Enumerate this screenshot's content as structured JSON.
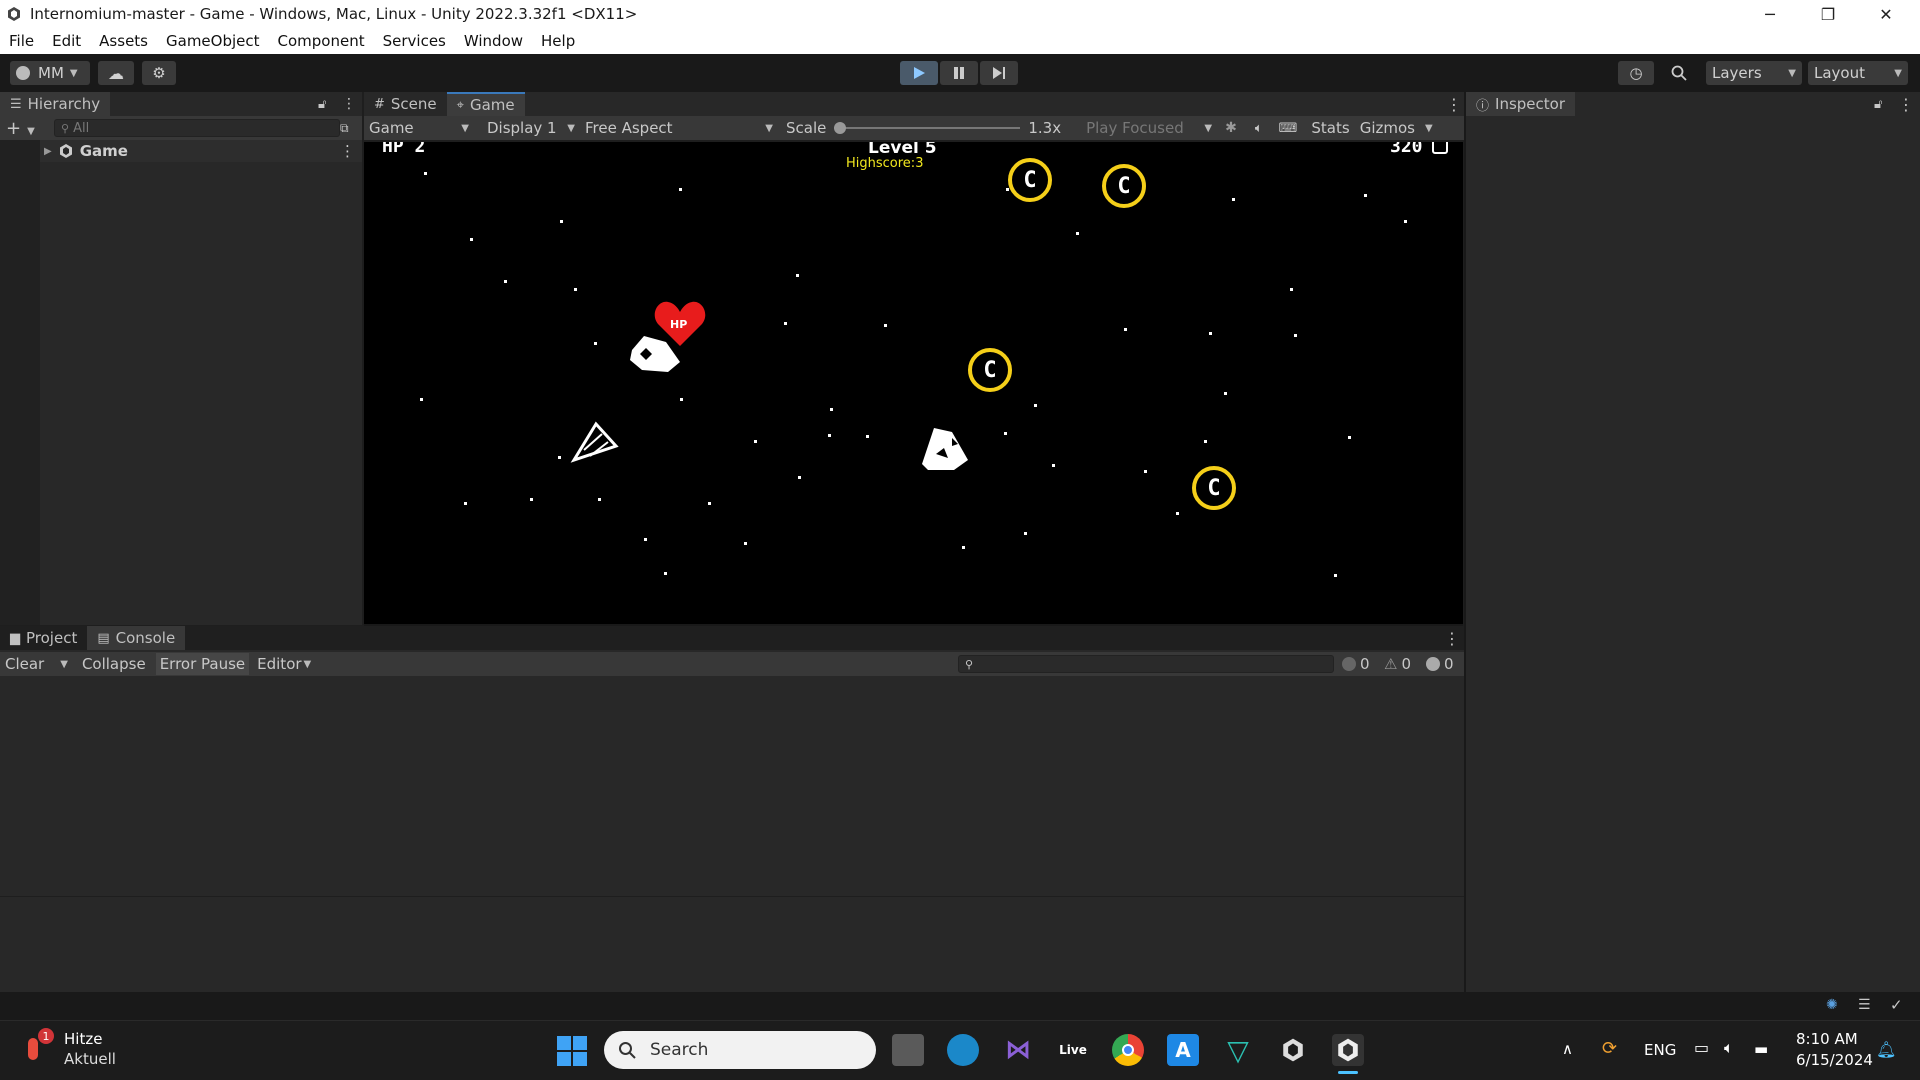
{
  "window": {
    "title": "Internomium-master - Game - Windows, Mac, Linux - Unity 2022.3.32f1 <DX11>",
    "minimize": "─",
    "restore": "❐",
    "close": "✕"
  },
  "menu": [
    "File",
    "Edit",
    "Assets",
    "GameObject",
    "Component",
    "Services",
    "Window",
    "Help"
  ],
  "toolbar": {
    "account": "MM",
    "layers": "Layers",
    "layout": "Layout"
  },
  "hierarchy": {
    "tab": "Hierarchy",
    "search_placeholder": "All",
    "root_item": "Game"
  },
  "viewtabs": {
    "scene": "Scene",
    "game": "Game"
  },
  "gamebar": {
    "view": "Game",
    "display": "Display 1",
    "aspect": "Free Aspect",
    "scale_label": "Scale",
    "scale_value": "1.3x",
    "play_mode": "Play Focused",
    "stats": "Stats",
    "gizmos": "Gizmos"
  },
  "game": {
    "hp": "HP 2",
    "level": "Level 5",
    "highscore": "Highscore:3",
    "score": "320",
    "heart_label": "HP",
    "coin_glyph": "C"
  },
  "inspector": {
    "tab": "Inspector"
  },
  "bottom": {
    "project_tab": "Project",
    "console_tab": "Console",
    "clear": "Clear",
    "collapse": "Collapse",
    "error_pause": "Error Pause",
    "editor": "Editor",
    "log_count": "0",
    "warning_count": "0",
    "error_count": "0"
  },
  "taskbar": {
    "weather_title": "Hitze",
    "weather_sub": "Aktuell",
    "weather_badge": "1",
    "search": "Search",
    "live_label": "Live",
    "language": "ENG",
    "time": "8:10 AM",
    "date": "6/15/2024"
  },
  "colors": {
    "accent": "#3a79bb",
    "coin": "#f5cf19",
    "highscore": "#f2e81f",
    "heart": "#e81c1c"
  }
}
